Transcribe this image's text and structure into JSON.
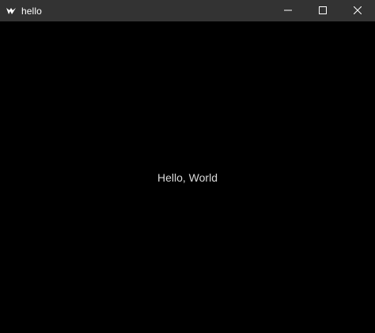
{
  "window": {
    "title": "hello",
    "icon": "kivy-logo-icon",
    "controls": [
      "minimize-icon",
      "maximize-icon",
      "close-icon"
    ],
    "titlebar_color": "#333333",
    "background_color": "#000000"
  },
  "content": {
    "label": "Hello, World",
    "label_color": "#d9d9d9"
  }
}
